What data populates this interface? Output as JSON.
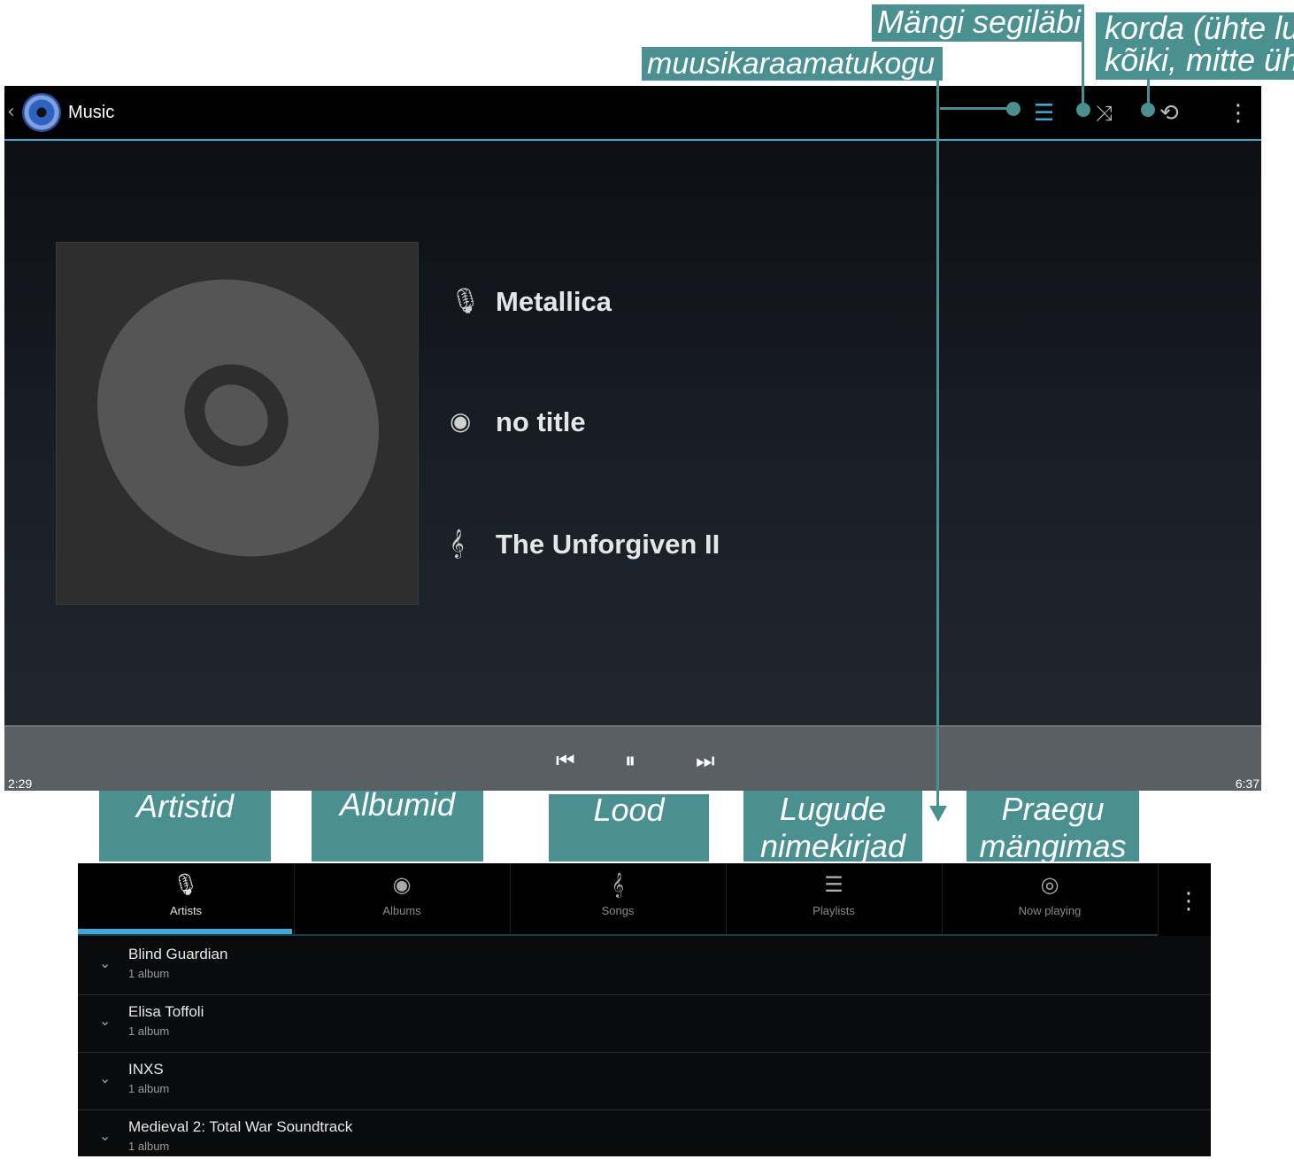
{
  "callouts": {
    "shuffle": "Mängi segiläbi",
    "library": "muusikaraamatukogu",
    "repeat_line1": "korda (ühte lu",
    "repeat_line2": "kõiki, mitte üht",
    "tabs": {
      "artists": "Artistid",
      "albums": "Albumid",
      "songs": "Lood",
      "playlists_line1": "Lugude",
      "playlists_line2": "nimekirjad",
      "now_playing_line1": "Praegu",
      "now_playing_line2": "mängimas"
    }
  },
  "player": {
    "app_title": "Music",
    "artist": "Metallica",
    "album": "no title",
    "song": "The Unforgiven II",
    "elapsed": "2:29",
    "duration": "6:37",
    "icons": {
      "back": "chevron-left-icon",
      "library": "list-icon",
      "shuffle": "shuffle-icon",
      "repeat": "repeat-icon",
      "overflow": "overflow-menu-icon",
      "prev": "skip-previous-icon",
      "pause": "pause-icon",
      "next": "skip-next-icon"
    }
  },
  "library": {
    "tabs": [
      {
        "label": "Artists"
      },
      {
        "label": "Albums"
      },
      {
        "label": "Songs"
      },
      {
        "label": "Playlists"
      },
      {
        "label": "Now playing"
      }
    ],
    "rows": [
      {
        "name": "Blind Guardian",
        "sub": "1 album"
      },
      {
        "name": "Elisa Toffoli",
        "sub": "1 album"
      },
      {
        "name": "INXS",
        "sub": "1 album"
      },
      {
        "name": "Medieval 2: Total War Soundtrack",
        "sub": "1 album"
      }
    ]
  },
  "colors": {
    "callout": "#4a9090",
    "accent": "#3ea8d6"
  }
}
